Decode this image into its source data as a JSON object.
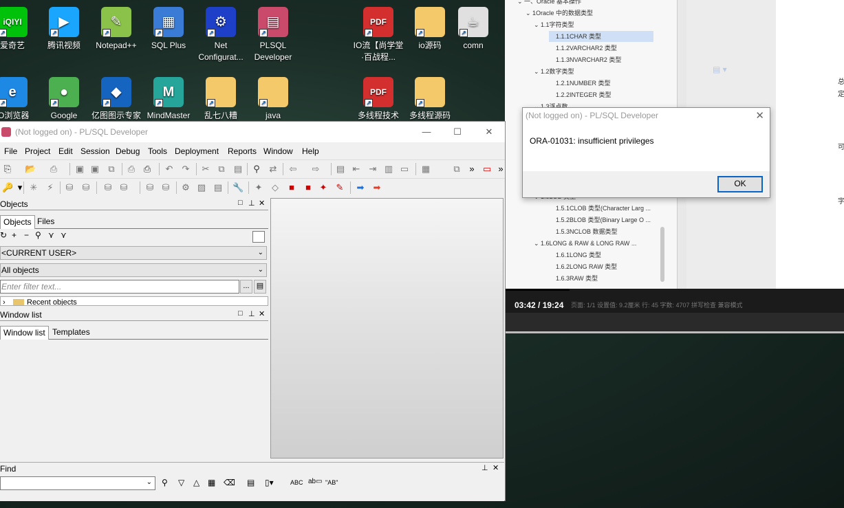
{
  "desktop_icons": [
    {
      "label": "爱奇艺",
      "icon": "iqiyi-icon",
      "color": "#00c20a",
      "text": "iQIYI"
    },
    {
      "label": "腾讯视频",
      "icon": "tencent-video-icon",
      "color": "#1aa6ff",
      "text": "▶"
    },
    {
      "label": "Notepad++",
      "icon": "notepad-plus-plus-icon",
      "color": "#8bc34a",
      "text": "✎"
    },
    {
      "label": "SQL Plus",
      "icon": "sqlplus-icon",
      "color": "#3a7bd5",
      "text": "▦"
    },
    {
      "label": "Net Configurat...",
      "icon": "net-configuration-icon",
      "color": "#1e40c8",
      "text": "⚙"
    },
    {
      "label": "PLSQL Developer",
      "icon": "plsql-developer-icon",
      "color": "#c94a6b",
      "text": "▤"
    },
    {
      "label": "IO流【尚学堂·百战程...",
      "icon": "pdf-icon",
      "color": "#d32f2f",
      "text": "PDF"
    },
    {
      "label": "io源码",
      "icon": "folder-icon",
      "color": "#f3c969",
      "text": ""
    },
    {
      "label": "comn",
      "icon": "java-icon",
      "color": "#e0e0e0",
      "text": "☕"
    },
    {
      "label": "IO浏览器",
      "icon": "ie-browser-icon",
      "color": "#1e88e5",
      "text": "e"
    },
    {
      "label": "Google",
      "icon": "chrome-icon",
      "color": "#4caf50",
      "text": "●"
    },
    {
      "label": "亿图图示专家",
      "icon": "edraw-icon",
      "color": "#1565c0",
      "text": "◆"
    },
    {
      "label": "MindMaster",
      "icon": "mindmaster-icon",
      "color": "#26a69a",
      "text": "M"
    },
    {
      "label": "乱七八糟",
      "icon": "folder-icon",
      "color": "#f3c969",
      "text": ""
    },
    {
      "label": "java",
      "icon": "folder-icon",
      "color": "#f3c969",
      "text": ""
    },
    {
      "label": "多线程技术【...",
      "icon": "pdf-icon",
      "color": "#d32f2f",
      "text": "PDF"
    },
    {
      "label": "多线程源码",
      "icon": "folder-icon",
      "color": "#f3c969",
      "text": ""
    }
  ],
  "doc_viewer": {
    "tree": [
      {
        "label": "一、Oracle 基本操作",
        "level": 0
      },
      {
        "label": "1Oracle 中的数据类型",
        "level": 1
      },
      {
        "label": "1.1字符类型",
        "level": 2
      },
      {
        "label": "1.1.1CHAR 类型",
        "level": 3,
        "selected": true
      },
      {
        "label": "1.1.2VARCHAR2 类型",
        "level": 3
      },
      {
        "label": "1.1.3NVARCHAR2 类型",
        "level": 3
      },
      {
        "label": "1.2数字类型",
        "level": 2
      },
      {
        "label": "1.2.1NUMBER 类型",
        "level": 3
      },
      {
        "label": "1.2.2INTEGER 类型",
        "level": 3
      },
      {
        "label": "1.3浮点数",
        "level": 2
      }
    ],
    "tree_lower": [
      {
        "label": "1.5LOB 类型",
        "level": 2
      },
      {
        "label": "1.5.1CLOB 类型(Character Larg ...",
        "level": 3
      },
      {
        "label": "1.5.2BLOB 类型(Binary Large O ...",
        "level": 3
      },
      {
        "label": "1.5.3NCLOB 数据类型",
        "level": 3
      },
      {
        "label": "1.6LONG & RAW & LONG RAW ...",
        "level": 2
      },
      {
        "label": "1.6.1LONG 类型",
        "level": 3
      },
      {
        "label": "1.6.2LONG RAW 类型",
        "level": 3
      },
      {
        "label": "1.6.3RAW 类型",
        "level": 3
      }
    ],
    "right_chars": [
      "总",
      "定",
      "可",
      "字"
    ],
    "video_time": "03:42 / 19:24",
    "status_line": "页面: 1/1   设置值: 9.2厘米   行: 45   字数: 4707   拼写检查   兼容模式",
    "progress": 0.19
  },
  "dialog": {
    "title": "(Not logged on) - PL/SQL Developer",
    "message": "ORA-01031: insufficient privileges",
    "ok_label": "OK"
  },
  "window": {
    "title": "(Not logged on) - PL/SQL Developer",
    "menu": [
      "File",
      "Project",
      "Edit",
      "Session",
      "Debug",
      "Tools",
      "Deployment",
      "Reports",
      "Window",
      "Help"
    ],
    "objects_pane": {
      "header": "Objects",
      "tabs": [
        "Objects",
        "Files"
      ],
      "user_combo": "<CURRENT USER>",
      "objects_combo": "All objects",
      "filter_placeholder": "Enter filter text...",
      "filter_btn": "...",
      "tree_item": "Recent objects"
    },
    "window_list_pane": {
      "header": "Window list",
      "tabs": [
        "Window list",
        "Templates"
      ]
    },
    "find": {
      "header": "Find",
      "abc": "ABC",
      "ab": "\"AB\""
    }
  }
}
